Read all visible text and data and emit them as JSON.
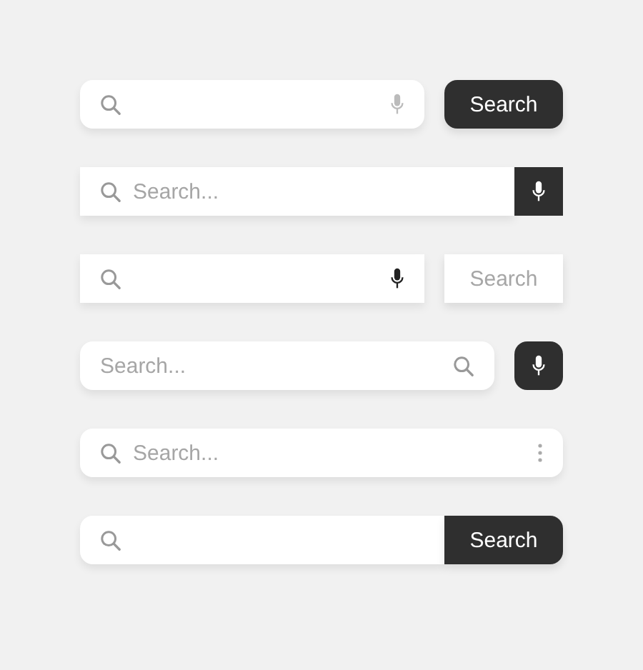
{
  "search_bars": [
    {
      "kind": "mic-then-button",
      "button_label": "Search"
    },
    {
      "kind": "attached-mic",
      "placeholder": "Search..."
    },
    {
      "kind": "mic-then-light-button",
      "button_label": "Search"
    },
    {
      "kind": "mic-apart",
      "placeholder": "Search..."
    },
    {
      "kind": "menu",
      "placeholder": "Search..."
    },
    {
      "kind": "attached-button",
      "button_label": "Search"
    }
  ]
}
